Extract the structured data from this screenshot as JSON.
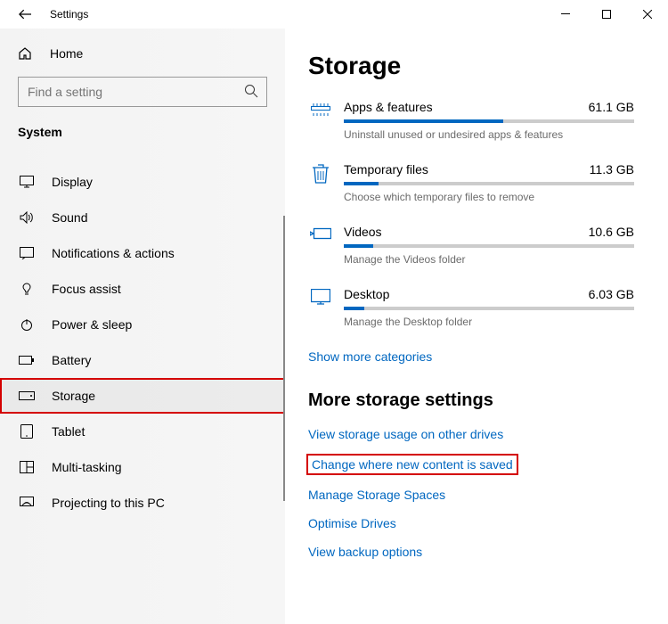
{
  "window": {
    "title": "Settings"
  },
  "sidebar": {
    "home": "Home",
    "search_placeholder": "Find a setting",
    "section": "System",
    "items": [
      {
        "label": "Display"
      },
      {
        "label": "Sound"
      },
      {
        "label": "Notifications & actions"
      },
      {
        "label": "Focus assist"
      },
      {
        "label": "Power & sleep"
      },
      {
        "label": "Battery"
      },
      {
        "label": "Storage"
      },
      {
        "label": "Tablet"
      },
      {
        "label": "Multi-tasking"
      },
      {
        "label": "Projecting to this PC"
      }
    ]
  },
  "main": {
    "title": "Storage",
    "items": [
      {
        "name": "Apps & features",
        "size": "61.1 GB",
        "desc": "Uninstall unused or undesired apps & features",
        "pct": 55
      },
      {
        "name": "Temporary files",
        "size": "11.3 GB",
        "desc": "Choose which temporary files to remove",
        "pct": 12
      },
      {
        "name": "Videos",
        "size": "10.6 GB",
        "desc": "Manage the Videos folder",
        "pct": 10
      },
      {
        "name": "Desktop",
        "size": "6.03 GB",
        "desc": "Manage the Desktop folder",
        "pct": 7
      }
    ],
    "show_more": "Show more categories",
    "more_title": "More storage settings",
    "links": [
      "View storage usage on other drives",
      "Change where new content is saved",
      "Manage Storage Spaces",
      "Optimise Drives",
      "View backup options"
    ]
  }
}
